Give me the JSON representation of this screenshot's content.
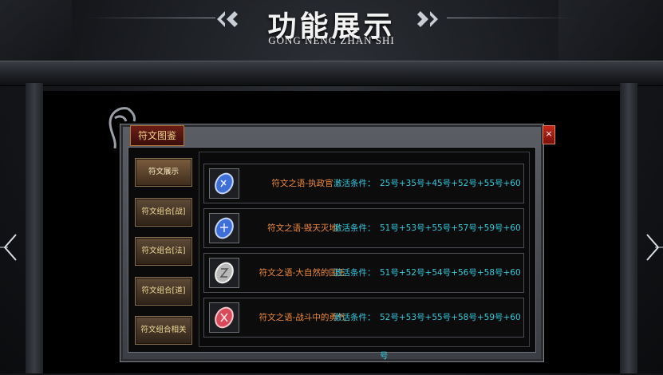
{
  "header": {
    "title": "功能展示",
    "subtitle": "GONG NENG ZHAN SHI"
  },
  "window": {
    "title": "符文图鉴",
    "close_label": "×"
  },
  "menu": [
    {
      "label": "符文展示",
      "active": true
    },
    {
      "label": "符文组合[战]",
      "active": false
    },
    {
      "label": "符文组合[法]",
      "active": false
    },
    {
      "label": "符文组合[道]",
      "active": false
    },
    {
      "label": "符文组合相关",
      "active": false
    }
  ],
  "runes": [
    {
      "name": "符文之语-执政官",
      "condition_label": "激活条件：",
      "condition": "25号+35号+45号+52号+55号+60号",
      "gem_color": "#3e6fd8"
    },
    {
      "name": "符文之语-毁天灭地",
      "condition_label": "激活条件：",
      "condition": "51号+53号+55号+57号+59号+60号",
      "gem_color": "#3e6fd8"
    },
    {
      "name": "符文之语-大自然的国王",
      "condition_label": "激活条件：",
      "condition": "51号+52号+54号+56号+58号+60号",
      "gem_color": "#b8b8b8"
    },
    {
      "name": "符文之语-战斗中的勇气",
      "condition_label": "激活条件：",
      "condition": "52号+53号+55号+58号+59号+60号",
      "gem_color": "#d84a5a"
    }
  ],
  "colors": {
    "rune_name": "#f08a3c",
    "condition": "#37c9d9",
    "menu_text": "#f3dc9a"
  }
}
